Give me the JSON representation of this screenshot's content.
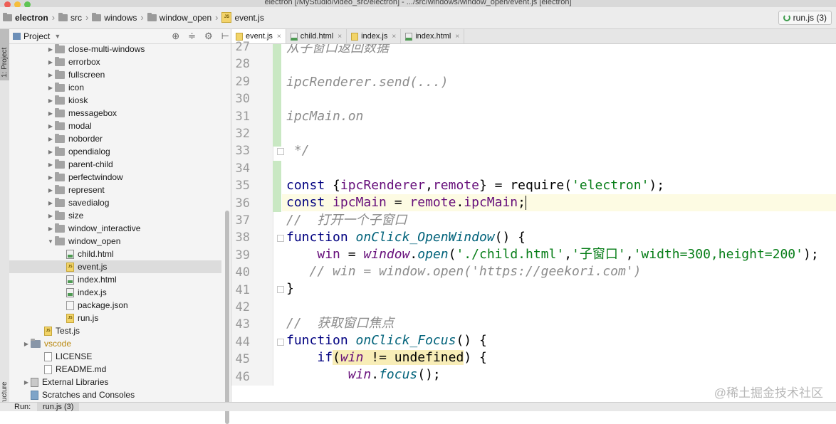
{
  "window": {
    "title": "electron [/MyStudio/video_src/electron] - .../src/windows/window_open/event.js [electron]"
  },
  "breadcrumbs": [
    "electron",
    "src",
    "windows",
    "window_open",
    "event.js"
  ],
  "run_config": {
    "label": "run.js (3)"
  },
  "side_tabs": {
    "project": "1: Project",
    "structure": "Structure"
  },
  "project_panel": {
    "title": "Project",
    "tree": [
      {
        "label": "close-multi-windows",
        "type": "folder",
        "depth": 2,
        "expanded": false
      },
      {
        "label": "errorbox",
        "type": "folder",
        "depth": 2,
        "expanded": false
      },
      {
        "label": "fullscreen",
        "type": "folder",
        "depth": 2,
        "expanded": false
      },
      {
        "label": "icon",
        "type": "folder",
        "depth": 2,
        "expanded": false
      },
      {
        "label": "kiosk",
        "type": "folder",
        "depth": 2,
        "expanded": false
      },
      {
        "label": "messagebox",
        "type": "folder",
        "depth": 2,
        "expanded": false
      },
      {
        "label": "modal",
        "type": "folder",
        "depth": 2,
        "expanded": false
      },
      {
        "label": "noborder",
        "type": "folder",
        "depth": 2,
        "expanded": false
      },
      {
        "label": "opendialog",
        "type": "folder",
        "depth": 2,
        "expanded": false
      },
      {
        "label": "parent-child",
        "type": "folder",
        "depth": 2,
        "expanded": false
      },
      {
        "label": "perfectwindow",
        "type": "folder",
        "depth": 2,
        "expanded": false
      },
      {
        "label": "represent",
        "type": "folder",
        "depth": 2,
        "expanded": false
      },
      {
        "label": "savedialog",
        "type": "folder",
        "depth": 2,
        "expanded": false
      },
      {
        "label": "size",
        "type": "folder",
        "depth": 2,
        "expanded": false
      },
      {
        "label": "window_interactive",
        "type": "folder",
        "depth": 2,
        "expanded": false
      },
      {
        "label": "window_open",
        "type": "folder",
        "depth": 2,
        "expanded": true
      },
      {
        "label": "child.html",
        "type": "html",
        "depth": 3
      },
      {
        "label": "event.js",
        "type": "js",
        "depth": 3,
        "selected": true
      },
      {
        "label": "index.html",
        "type": "html",
        "depth": 3
      },
      {
        "label": "index.js",
        "type": "html",
        "depth": 3
      },
      {
        "label": "package.json",
        "type": "json",
        "depth": 3
      },
      {
        "label": "run.js",
        "type": "js",
        "depth": 3
      },
      {
        "label": "Test.js",
        "type": "js",
        "depth": 1
      },
      {
        "label": "vscode",
        "type": "vsfolder",
        "depth": 0,
        "expanded": false
      },
      {
        "label": "LICENSE",
        "type": "txt",
        "depth": 1
      },
      {
        "label": "README.md",
        "type": "txt",
        "depth": 1
      },
      {
        "label": "External Libraries",
        "type": "lib",
        "depth": 0,
        "expanded": false
      },
      {
        "label": "Scratches and Consoles",
        "type": "scratch",
        "depth": 0
      }
    ]
  },
  "editor_tabs": [
    {
      "label": "event.js",
      "type": "js",
      "active": true
    },
    {
      "label": "child.html",
      "type": "html",
      "active": false
    },
    {
      "label": "index.js",
      "type": "js",
      "active": false
    },
    {
      "label": "index.html",
      "type": "html",
      "active": false
    }
  ],
  "code": {
    "line_numbers": [
      "27",
      "28",
      "29",
      "30",
      "31",
      "32",
      "33",
      "34",
      "35",
      "36",
      "37",
      "38",
      "39",
      "40",
      "41",
      "42",
      "43",
      "44",
      "45",
      "46"
    ],
    "top_partial": "从子窗口返回数据",
    "l29": "ipcRenderer.send(...)",
    "l31": "ipcMain.on",
    "l33": " */",
    "l35": {
      "k": "const",
      "a": " {",
      "b": "ipcRenderer",
      "c": ",",
      "d": "remote",
      "e": "} = ",
      "f": "require",
      "g": "(",
      "h": "'electron'",
      "i": ");"
    },
    "l36": {
      "k": "const",
      "a": " ",
      "b": "ipcMain",
      "c": " = ",
      "d": "remote",
      "e": ".",
      "f": "ipcMain",
      "g": ";"
    },
    "l37": "//  打开一个子窗口",
    "l38": {
      "k": "function",
      "a": " ",
      "b": "onClick_OpenWindow",
      "c": "() {"
    },
    "l39": {
      "a": "    ",
      "b": "win",
      "c": " = ",
      "d": "window",
      "e": ".",
      "f": "open",
      "g": "(",
      "h": "'./child.html'",
      "i": ",",
      "j": "'子窗口'",
      "l": ",",
      "m": "'width=300,height=200'",
      "n": ");"
    },
    "l40": "   // win = window.open('https://geekori.com')",
    "l41": "}",
    "l43": "//  获取窗口焦点",
    "l44": {
      "k": "function",
      "a": " ",
      "b": "onClick_Focus",
      "c": "() {"
    },
    "l45": {
      "a": "    ",
      "k": "if",
      "b": "(",
      "c": "win",
      "d": " != ",
      "e": "undefined",
      "f": ") {"
    },
    "l46": {
      "a": "        ",
      "b": "win",
      "c": ".",
      "d": "focus",
      "e": "();"
    }
  },
  "watermark": "@稀土掘金技术社区",
  "run_bar": {
    "label": "Run:",
    "tab": "run.js (3)"
  },
  "colors": {
    "keyword": "#000080",
    "string": "#067d17",
    "comment": "#8c8c8c",
    "function": "#00627a",
    "variable": "#660e7a",
    "change_marker": "#c9e8c3",
    "current_line": "#fdfbe3"
  }
}
